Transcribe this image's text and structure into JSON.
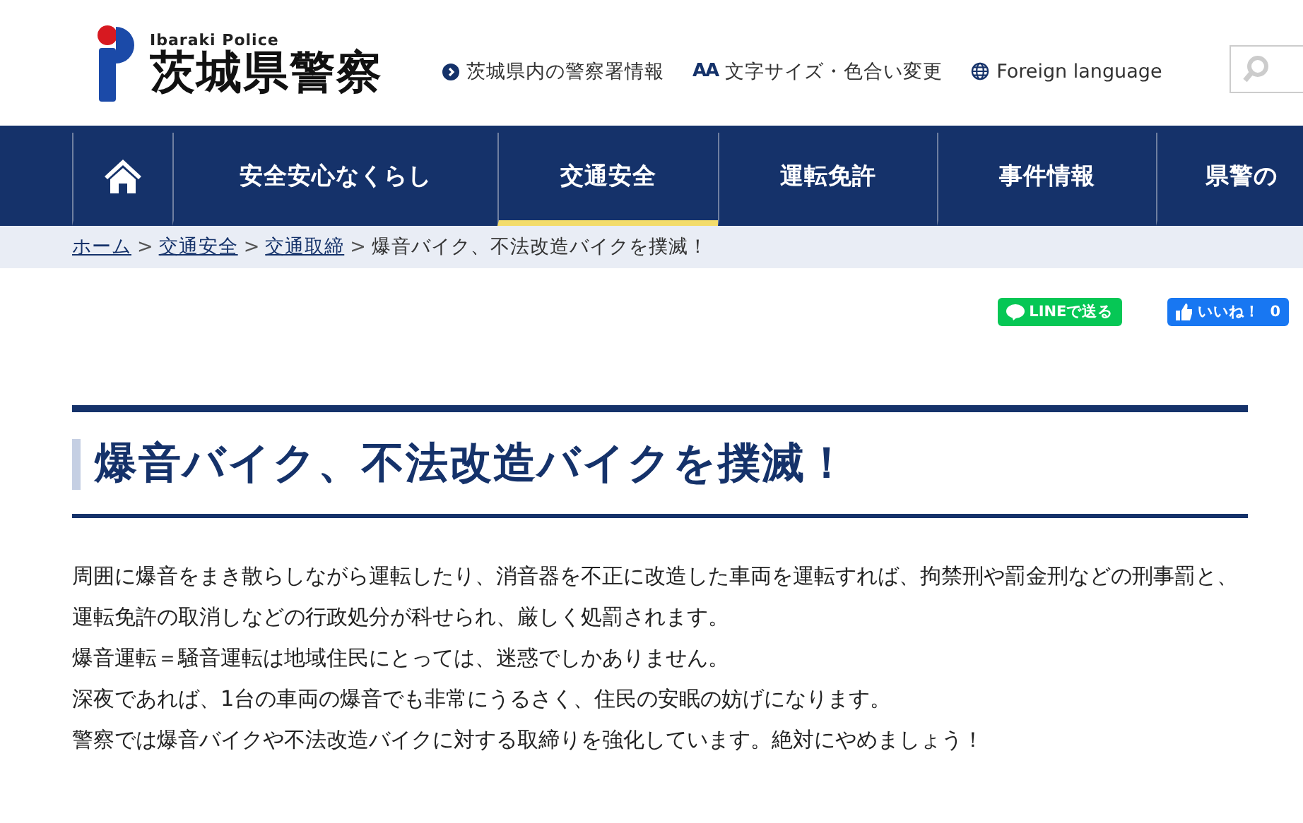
{
  "header": {
    "logo_en": "Ibaraki Police",
    "logo_ja": "茨城県警察",
    "links": [
      {
        "kind": "police-stations",
        "label": "茨城県内の警察署情報"
      },
      {
        "kind": "text-size",
        "label": "文字サイズ・色合い変更",
        "icon_text": "AA"
      },
      {
        "kind": "language",
        "label": "Foreign language"
      }
    ]
  },
  "nav": {
    "items": [
      {
        "label": "安全安心なくらし",
        "selected": false
      },
      {
        "label": "交通安全",
        "selected": true
      },
      {
        "label": "運転免許",
        "selected": false
      },
      {
        "label": "事件情報",
        "selected": false
      },
      {
        "label": "県警の",
        "selected": false
      }
    ]
  },
  "breadcrumb": {
    "links": [
      "ホーム",
      "交通安全",
      "交通取締"
    ],
    "separator": ">",
    "current": "爆音バイク、不法改造バイクを撲滅！"
  },
  "share": {
    "line": "LINEで送る",
    "like": "いいね！",
    "like_count": "0"
  },
  "article": {
    "title": "爆音バイク、不法改造バイクを撲滅！",
    "paragraphs": [
      "周囲に爆音をまき散らしながら運転したり、消音器を不正に改造した車両を運転すれば、拘禁刑や罰金刑などの刑事罰と、運転免許の取消しなどの行政処分が科せられ、厳しく処罰されます。",
      "爆音運転＝騒音運転は地域住民にとっては、迷惑でしかありません。",
      "深夜であれば、1台の車両の爆音でも非常にうるさく、住民の安眠の妨げになります。",
      "警察では爆音バイクや不法改造バイクに対する取締りを強化しています。絶対にやめましょう！"
    ]
  }
}
